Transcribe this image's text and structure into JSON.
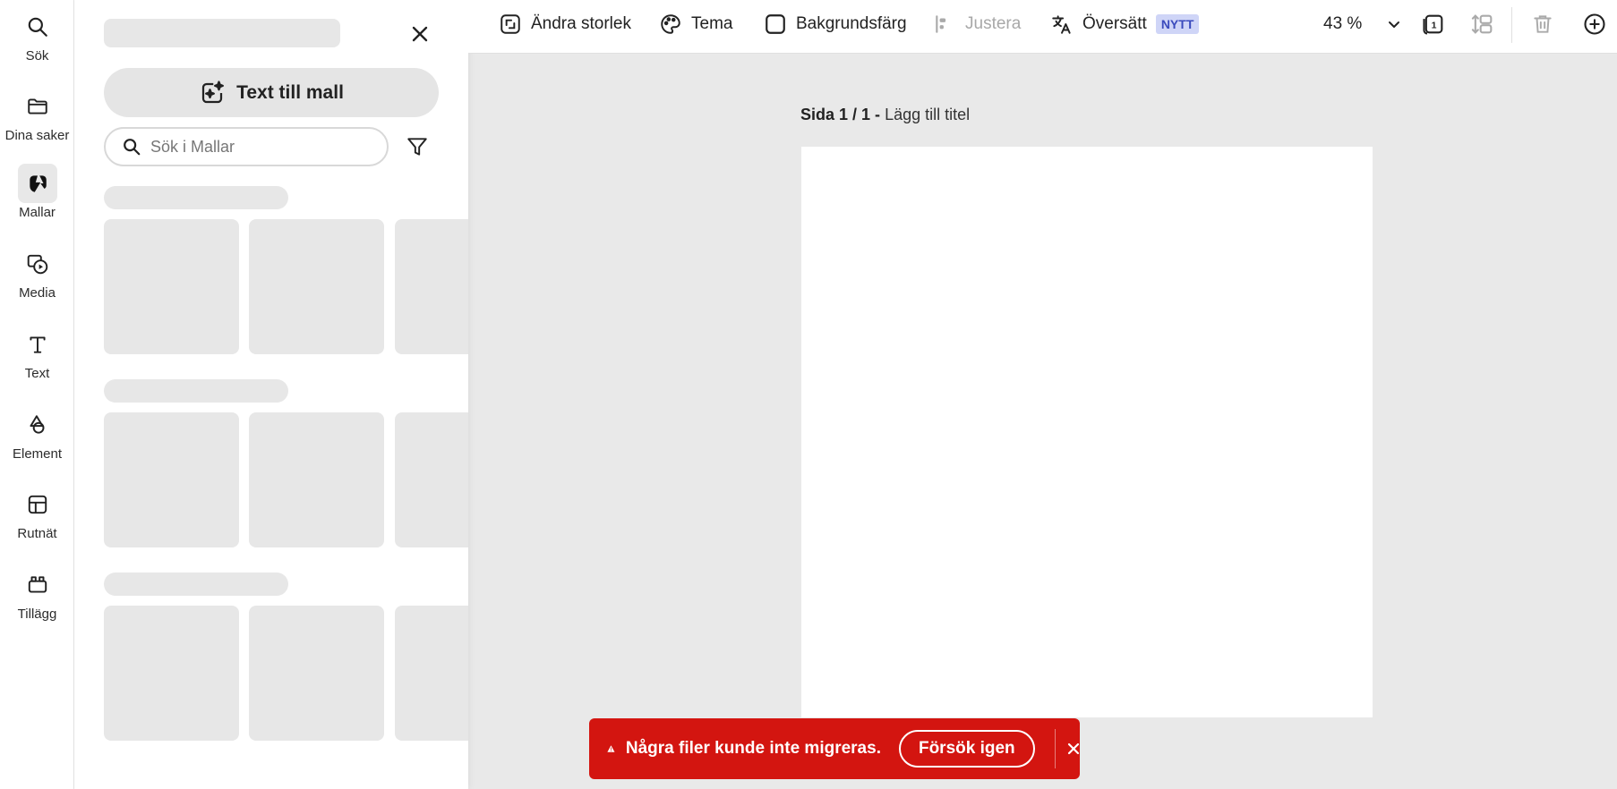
{
  "sidebar": {
    "items": [
      {
        "label": "Sök",
        "icon": "search-icon"
      },
      {
        "label": "Dina saker",
        "icon": "folder-icon"
      },
      {
        "label": "Mallar",
        "icon": "templates-icon",
        "active": true
      },
      {
        "label": "Media",
        "icon": "media-icon"
      },
      {
        "label": "Text",
        "icon": "text-icon"
      },
      {
        "label": "Element",
        "icon": "shapes-icon"
      },
      {
        "label": "Rutnät",
        "icon": "grid-icon"
      },
      {
        "label": "Tillägg",
        "icon": "addons-icon"
      }
    ]
  },
  "panel": {
    "text_to_template_label": "Text till mall",
    "search_placeholder": "Sök i Mallar",
    "loading": true
  },
  "toolbar": {
    "resize_label": "Ändra storlek",
    "theme_label": "Tema",
    "background_label": "Bakgrundsfärg",
    "align_label": "Justera",
    "translate_label": "Översätt",
    "new_badge": "NYTT",
    "zoom_value": "43 %",
    "page_count": "1"
  },
  "canvas": {
    "page_indicator": "Sida 1 / 1 -",
    "page_title_placeholder": "Lägg till titel"
  },
  "toast": {
    "message": "Några filer kunde inte migreras.",
    "retry_label": "Försök igen",
    "color": "#d31510"
  }
}
